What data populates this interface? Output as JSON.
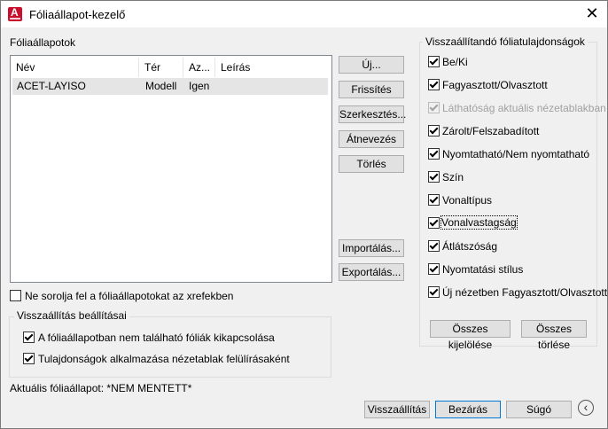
{
  "window": {
    "title": "Fóliaállapot-kezelő",
    "app_icon_letter": "A",
    "close_glyph": "✕"
  },
  "layer_states": {
    "label": "Fóliaállapotok",
    "columns": [
      "Név",
      "Tér",
      "Az...",
      "Leírás"
    ],
    "rows": [
      {
        "name": "ACET-LAYISO",
        "space": "Modell",
        "same": "Igen",
        "description": ""
      }
    ]
  },
  "side_buttons": {
    "new": "Új...",
    "update": "Frissítés",
    "edit": "Szerkesztés...",
    "rename": "Átnevezés",
    "delete": "Törlés",
    "import": "Importálás...",
    "export": "Exportálás..."
  },
  "xref_option": {
    "label": "Ne sorolja fel a fóliaállapotokat az xrefekben",
    "checked": false
  },
  "restore_options": {
    "legend": "Visszaállítás beállításai",
    "items": [
      {
        "label": "A fóliaállapotban nem található fóliák kikapcsolása",
        "checked": true
      },
      {
        "label": "Tulajdonságok alkalmazása nézetablak felülírásaként",
        "checked": true
      }
    ]
  },
  "current_state": {
    "label": "Aktuális fóliaállapot: *NEM MENTETT*"
  },
  "properties": {
    "legend": "Visszaállítandó fóliatulajdonságok",
    "items": [
      {
        "label": "Be/Ki",
        "checked": true,
        "enabled": true
      },
      {
        "label": "Fagyasztott/Olvasztott",
        "checked": true,
        "enabled": true
      },
      {
        "label": "Láthatóság aktuális nézetablakban",
        "checked": true,
        "enabled": false
      },
      {
        "label": "Zárolt/Felszabadított",
        "checked": true,
        "enabled": true
      },
      {
        "label": "Nyomtatható/Nem nyomtatható",
        "checked": true,
        "enabled": true
      },
      {
        "label": "Szín",
        "checked": true,
        "enabled": true
      },
      {
        "label": "Vonaltípus",
        "checked": true,
        "enabled": true
      },
      {
        "label": "Vonalvastagság",
        "checked": true,
        "enabled": true
      },
      {
        "label": "Átlátszóság",
        "checked": true,
        "enabled": true
      },
      {
        "label": "Nyomtatási stílus",
        "checked": true,
        "enabled": true
      },
      {
        "label": "Új nézetben Fagyasztott/Olvasztott",
        "checked": true,
        "enabled": true
      }
    ],
    "select_all": "Összes kijelölése",
    "clear_all": "Összes törlése"
  },
  "footer": {
    "restore": "Visszaállítás",
    "close": "Bezárás",
    "help": "Súgó",
    "back_glyph": "‹"
  },
  "colors": {
    "accent": "#0078d7",
    "brand": "#c8102e",
    "disabled_text": "#a0a0a0"
  }
}
